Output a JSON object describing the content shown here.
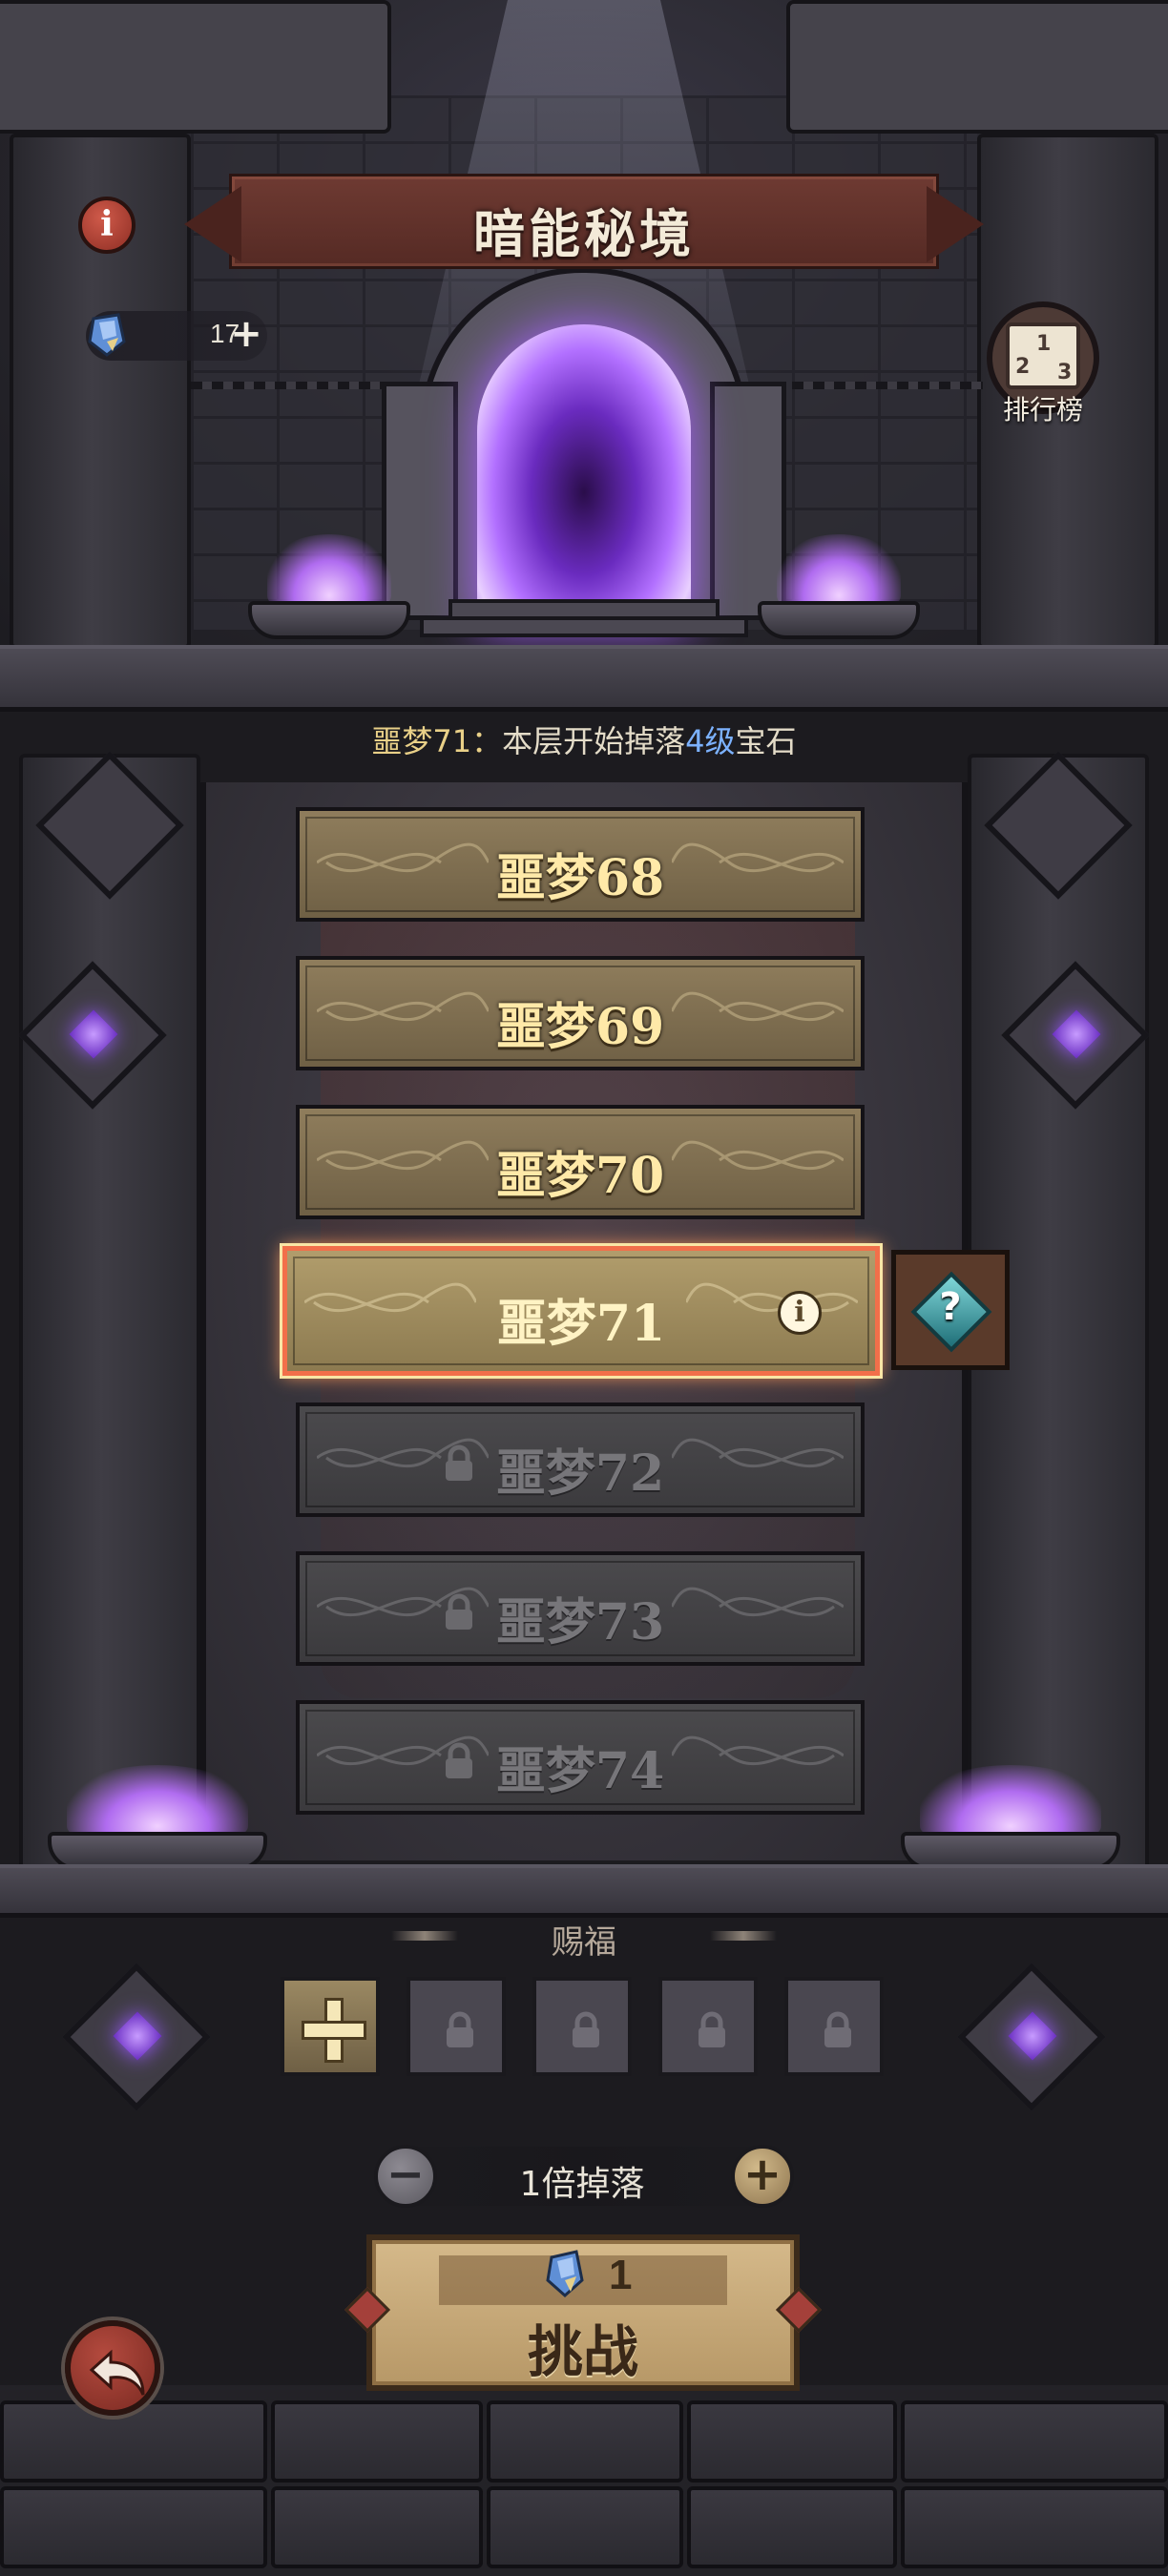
{
  "header": {
    "title": "暗能秘境",
    "info_icon": "info-icon",
    "currency": {
      "icon": "blue-gem-icon",
      "count": "17",
      "plus": "+"
    },
    "rank": {
      "label": "排行榜",
      "icon": "podium-icon"
    }
  },
  "hint": {
    "prefix": "噩梦71：",
    "middle": "本层开始掉落",
    "highlight": "4级",
    "suffix": "宝石"
  },
  "levels": [
    {
      "label": "噩梦68",
      "state": "unlocked"
    },
    {
      "label": "噩梦69",
      "state": "unlocked"
    },
    {
      "label": "噩梦70",
      "state": "unlocked"
    },
    {
      "label": "噩梦71",
      "state": "selected"
    },
    {
      "label": "噩梦72",
      "state": "locked"
    },
    {
      "label": "噩梦73",
      "state": "locked"
    },
    {
      "label": "噩梦74",
      "state": "locked"
    }
  ],
  "mystery": {
    "label": "?"
  },
  "blessing": {
    "title": "赐福",
    "slots": [
      "add",
      "locked",
      "locked",
      "locked",
      "locked"
    ]
  },
  "multiplier": {
    "label": "1倍掉落",
    "minus": "−",
    "plus": "+"
  },
  "challenge": {
    "cost": "1",
    "cost_icon": "blue-gem-icon",
    "label": "挑战"
  },
  "colors": {
    "hint_highlight": "#7cb2ff",
    "selected_border": "#f26f4a",
    "portal_glow": "#a760ff"
  }
}
